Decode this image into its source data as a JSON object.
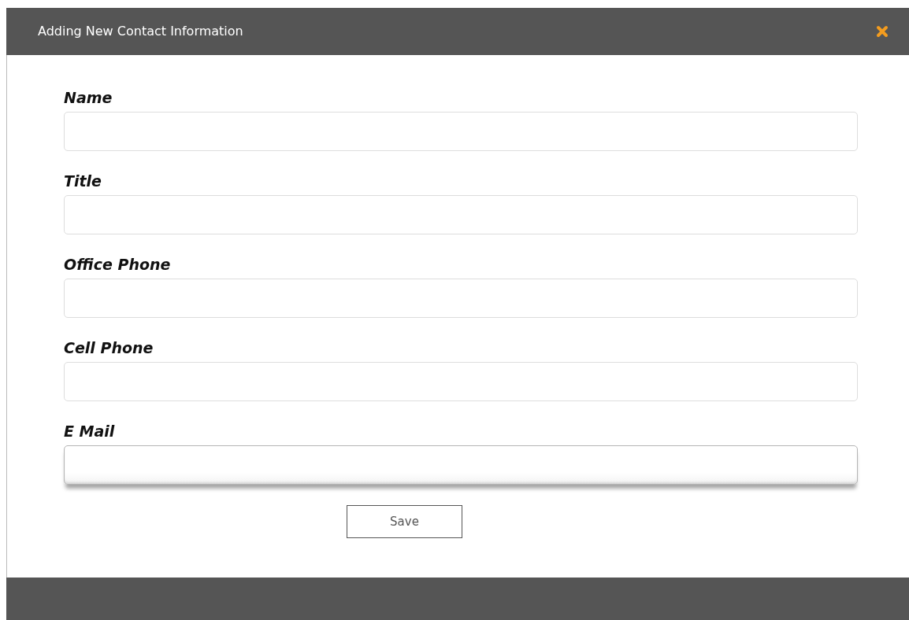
{
  "dialog": {
    "title": "Adding New Contact Information"
  },
  "fields": [
    {
      "label": "Name",
      "focused": false
    },
    {
      "label": "Title",
      "focused": false
    },
    {
      "label": "Office Phone",
      "focused": false
    },
    {
      "label": "Cell Phone",
      "focused": false
    },
    {
      "label": "E Mail",
      "focused": true
    }
  ],
  "buttons": [
    {
      "label": "Save"
    }
  ]
}
